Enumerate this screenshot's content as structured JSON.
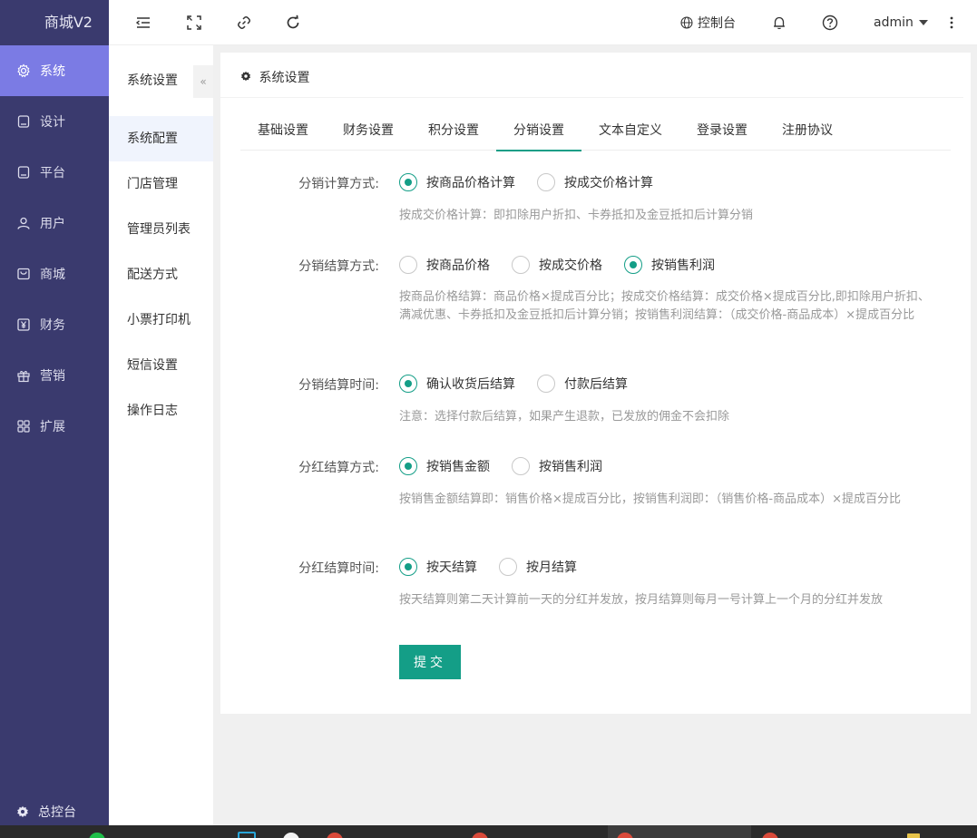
{
  "app": {
    "title": "商城V2"
  },
  "sidebar": {
    "items": [
      {
        "label": "系统",
        "icon": "gear-icon"
      },
      {
        "label": "设计",
        "icon": "monitor-icon"
      },
      {
        "label": "平台",
        "icon": "tablet-icon"
      },
      {
        "label": "用户",
        "icon": "user-icon"
      },
      {
        "label": "商城",
        "icon": "shop-icon"
      },
      {
        "label": "财务",
        "icon": "yen-icon"
      },
      {
        "label": "营销",
        "icon": "gift-icon"
      },
      {
        "label": "扩展",
        "icon": "grid-icon"
      }
    ],
    "bottom_label": "总控台"
  },
  "topbar": {
    "console_label": "控制台",
    "user": "admin"
  },
  "subnav": {
    "title": "系统设置",
    "collapse_glyph": "«",
    "items": [
      {
        "label": "系统配置"
      },
      {
        "label": "门店管理"
      },
      {
        "label": "管理员列表"
      },
      {
        "label": "配送方式"
      },
      {
        "label": "小票打印机"
      },
      {
        "label": "短信设置"
      },
      {
        "label": "操作日志"
      }
    ]
  },
  "card": {
    "title": "系统设置",
    "tabs": [
      {
        "label": "基础设置"
      },
      {
        "label": "财务设置"
      },
      {
        "label": "积分设置"
      },
      {
        "label": "分销设置"
      },
      {
        "label": "文本自定义"
      },
      {
        "label": "登录设置"
      },
      {
        "label": "注册协议"
      }
    ],
    "active_tab": "分销设置"
  },
  "form": {
    "calc": {
      "label": "分销计算方式:",
      "options": [
        "按商品价格计算",
        "按成交价格计算"
      ],
      "selected": "按商品价格计算",
      "help": "按成交价格计算：即扣除用户折扣、卡券抵扣及金豆抵扣后计算分销"
    },
    "settle_method": {
      "label": "分销结算方式:",
      "options": [
        "按商品价格",
        "按成交价格",
        "按销售利润"
      ],
      "selected": "按销售利润",
      "help": "按商品价格结算：商品价格×提成百分比；按成交价格结算：成交价格×提成百分比,即扣除用户折扣、满减优惠、卡券抵扣及金豆抵扣后计算分销；按销售利润结算：（成交价格-商品成本）×提成百分比"
    },
    "settle_time": {
      "label": "分销结算时间:",
      "options": [
        "确认收货后结算",
        "付款后结算"
      ],
      "selected": "确认收货后结算",
      "help": "注意：选择付款后结算，如果产生退款，已发放的佣金不会扣除"
    },
    "bonus_method": {
      "label": "分红结算方式:",
      "options": [
        "按销售金额",
        "按销售利润"
      ],
      "selected": "按销售金额",
      "help": "按销售金额结算即：销售价格×提成百分比，按销售利润即：（销售价格-商品成本）×提成百分比"
    },
    "bonus_time": {
      "label": "分红结算时间:",
      "options": [
        "按天结算",
        "按月结算"
      ],
      "selected": "按天结算",
      "help": "按天结算则第二天计算前一天的分红并发放，按月结算则每月一号计算上一个月的分红并发放"
    },
    "submit_label": "提交"
  },
  "colors": {
    "sidebar_bg": "#3a3a6e",
    "sidebar_active": "#7b7be4",
    "accent": "#149e87"
  }
}
